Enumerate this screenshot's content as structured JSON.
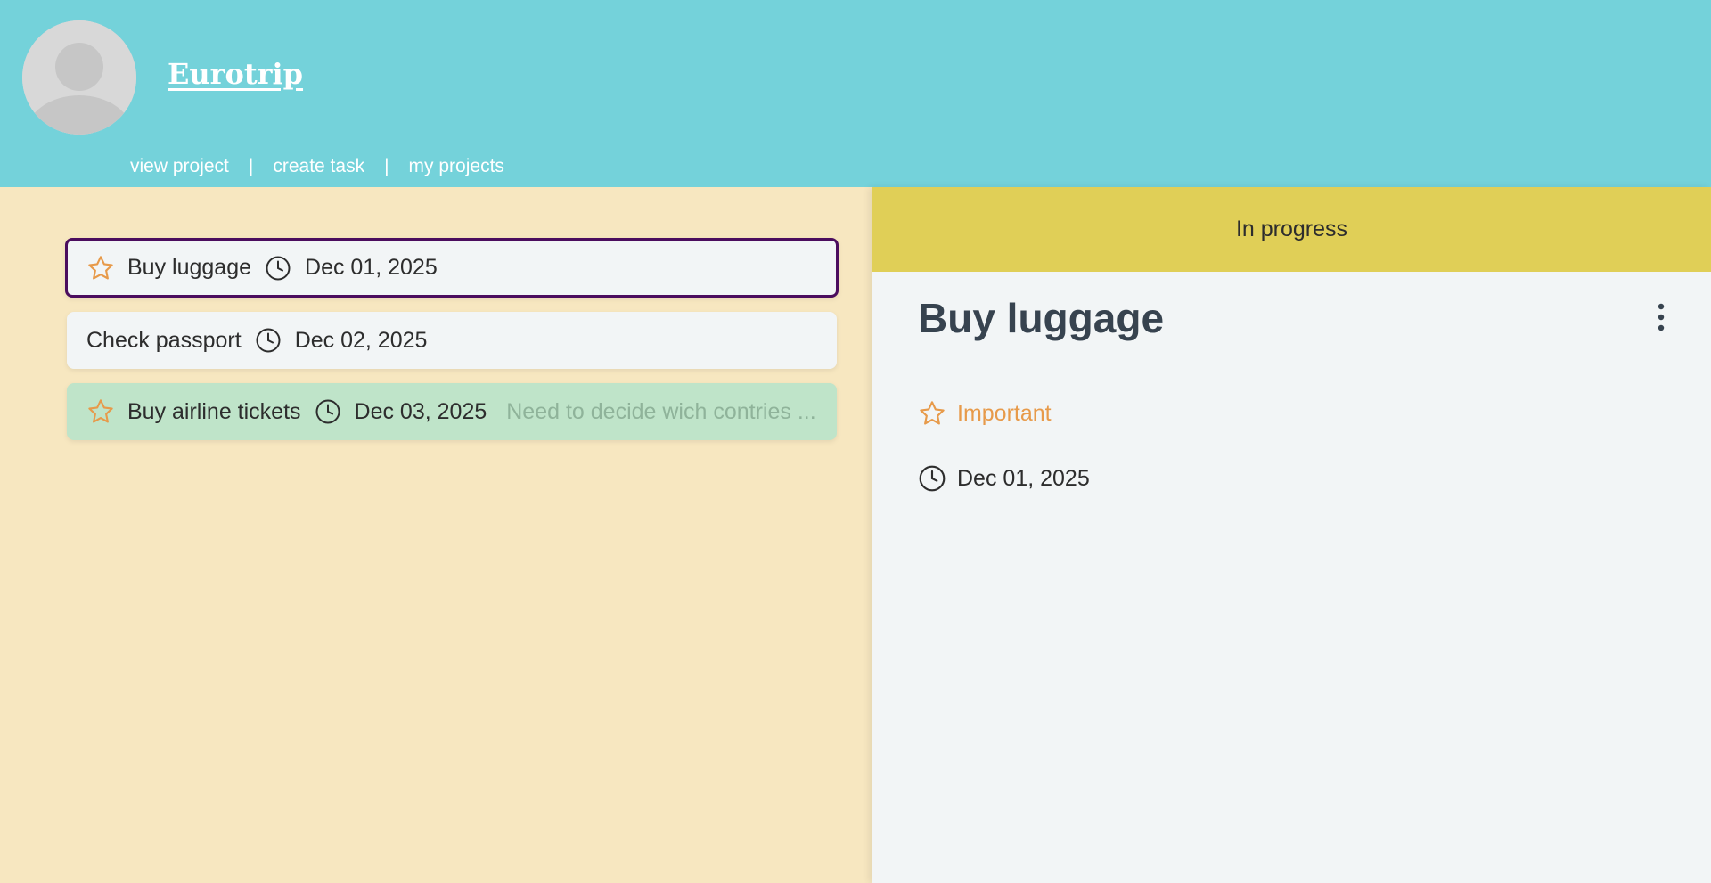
{
  "header": {
    "project_title": "Eurotrip",
    "nav": [
      {
        "label": "view project"
      },
      {
        "label": "create task"
      },
      {
        "label": "my projects"
      }
    ],
    "separator": "|"
  },
  "tasks": [
    {
      "title": "Buy luggage",
      "date": "Dec 01, 2025",
      "starred": true,
      "note": "",
      "state": "selected"
    },
    {
      "title": "Check passport",
      "date": "Dec 02, 2025",
      "starred": false,
      "note": "",
      "state": "normal"
    },
    {
      "title": "Buy airline tickets",
      "date": "Dec 03, 2025",
      "starred": true,
      "note": "Need to decide wich contries ...",
      "state": "done"
    }
  ],
  "detail": {
    "status": "In progress",
    "title": "Buy luggage",
    "important_label": "Important",
    "due_date": "Dec 01, 2025"
  },
  "colors": {
    "header_bg": "#74d2da",
    "left_bg": "#f7e7c0",
    "status_bg": "#e0cf57",
    "star": "#e79a4a",
    "selected_border": "#4b0d5e",
    "done_bg": "#bfe4c9"
  },
  "icons": {
    "avatar": "user-silhouette-icon",
    "star": "star-outline-icon",
    "clock": "clock-icon",
    "menu": "vertical-dots-icon"
  }
}
